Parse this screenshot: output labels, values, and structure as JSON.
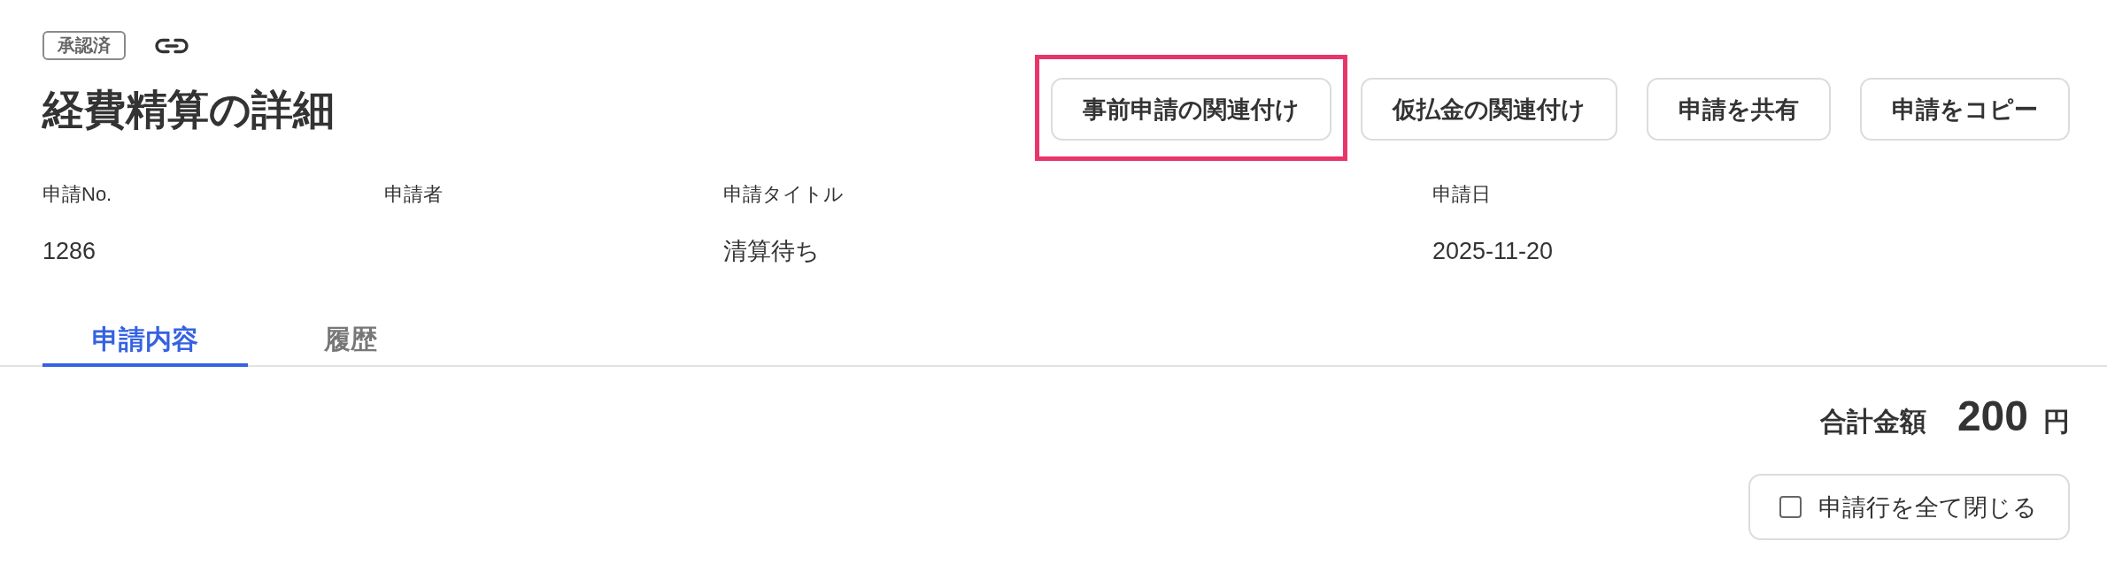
{
  "header": {
    "status_badge": "承認済",
    "title": "経費精算の詳細"
  },
  "actions": [
    {
      "label": "事前申請の関連付け",
      "highlighted": true
    },
    {
      "label": "仮払金の関連付け",
      "highlighted": false
    },
    {
      "label": "申請を共有",
      "highlighted": false
    },
    {
      "label": "申請をコピー",
      "highlighted": false
    }
  ],
  "fields": [
    {
      "label": "申請No.",
      "value": "1286"
    },
    {
      "label": "申請者"
    },
    {
      "label": "申請タイトル",
      "value": "清算待ち"
    },
    {
      "label": "申請日",
      "value": "2025-11-20"
    }
  ],
  "tabs": [
    {
      "label": "申請内容",
      "selected": true
    },
    {
      "label": "履歴",
      "selected": false
    }
  ],
  "total": {
    "label": "合計金額",
    "amount": "200",
    "unit": "円"
  },
  "collapse_toggle": {
    "label": "申請行を全て閉じる",
    "checked": false
  }
}
